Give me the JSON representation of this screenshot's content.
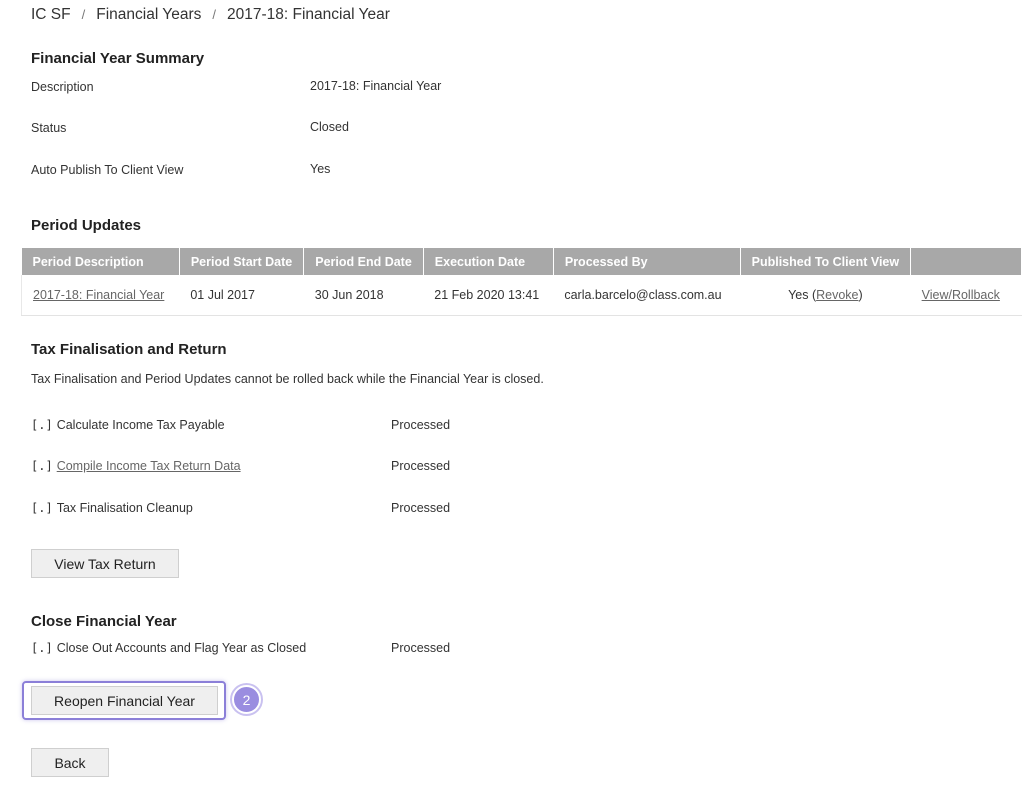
{
  "breadcrumb": [
    "IC SF",
    "Financial Years",
    "2017-18: Financial Year"
  ],
  "summary": {
    "title": "Financial Year Summary",
    "rows": [
      {
        "label": "Description",
        "value": "2017-18: Financial Year"
      },
      {
        "label": "Status",
        "value": "Closed"
      },
      {
        "label": "Auto Publish To Client View",
        "value": "Yes"
      }
    ]
  },
  "period_updates": {
    "title": "Period Updates",
    "columns": [
      "Period Description",
      "Period Start Date",
      "Period End Date",
      "Execution Date",
      "Processed By",
      "Published To Client View",
      ""
    ],
    "rows": [
      {
        "description": "2017-18: Financial Year",
        "start": "01 Jul 2017",
        "end": "30 Jun 2018",
        "execution": "21 Feb 2020 13:41",
        "processed_by": "carla.barcelo@class.com.au",
        "published": "Yes",
        "revoke": "Revoke",
        "action": "View/Rollback"
      }
    ]
  },
  "tax": {
    "title": "Tax Finalisation and Return",
    "description": "Tax Finalisation and Period Updates cannot be rolled back while the Financial Year is closed.",
    "bracket": "[.]",
    "steps": [
      {
        "label": "Calculate Income Tax Payable",
        "status": "Processed"
      },
      {
        "label": "Compile Income Tax Return Data",
        "status": "Processed"
      },
      {
        "label": "Tax Finalisation Cleanup",
        "status": "Processed"
      }
    ],
    "view_button": "View Tax Return"
  },
  "close": {
    "title": "Close Financial Year",
    "step": {
      "label": "Close Out Accounts and Flag Year as Closed",
      "status": "Processed"
    },
    "reopen_button": "Reopen Financial Year",
    "badge": "2"
  },
  "back_button": "Back",
  "colors": {
    "header_bg": "#a8a8a8",
    "highlight": "#8b7fd8",
    "badge": "#9a8de0"
  }
}
